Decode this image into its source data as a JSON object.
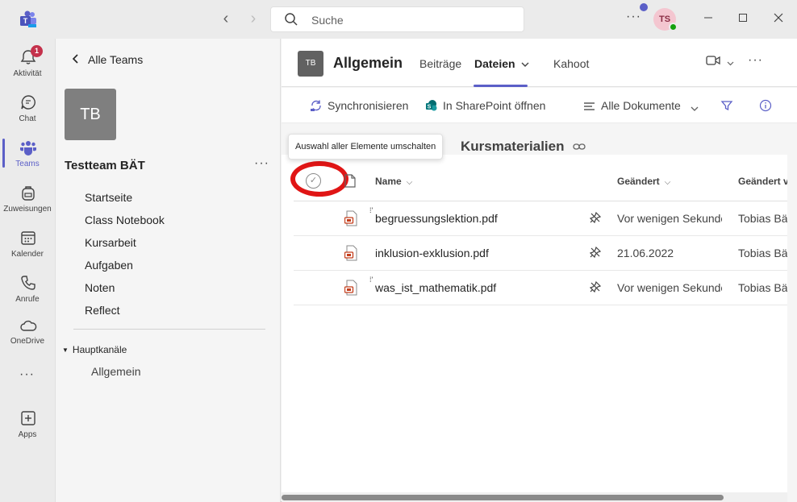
{
  "titlebar": {
    "search_placeholder": "Suche",
    "more": "···",
    "avatar_initials": "TS"
  },
  "rail": {
    "items": [
      {
        "label": "Aktivität",
        "icon": "bell-icon",
        "badge": "1"
      },
      {
        "label": "Chat",
        "icon": "chat-icon"
      },
      {
        "label": "Teams",
        "icon": "teams-icon",
        "active": true
      },
      {
        "label": "Zuweisungen",
        "icon": "backpack-icon"
      },
      {
        "label": "Kalender",
        "icon": "calendar-icon"
      },
      {
        "label": "Anrufe",
        "icon": "phone-icon"
      },
      {
        "label": "OneDrive",
        "icon": "cloud-icon"
      },
      {
        "label": "Apps",
        "icon": "plus-box-icon"
      }
    ],
    "more": "···"
  },
  "team_panel": {
    "back_label": "Alle Teams",
    "avatar_initials": "TB",
    "team_name": "Testteam BÄT",
    "more": "···",
    "links": [
      "Startseite",
      "Class Notebook",
      "Kursarbeit",
      "Aufgaben",
      "Noten",
      "Reflect"
    ],
    "section_title": "Hauptkanäle",
    "channels": [
      "Allgemein"
    ]
  },
  "channel_header": {
    "avatar_initials": "TB",
    "title": "Allgemein",
    "tabs": [
      "Beiträge",
      "Dateien",
      "Kahoot"
    ],
    "active_tab": "Dateien",
    "more": "···"
  },
  "toolbar": {
    "sync_label": "Synchronisieren",
    "sharepoint_label": "In SharePoint öffnen",
    "view_label": "Alle Dokumente"
  },
  "tooltip": "Auswahl aller Elemente umschalten",
  "folder": {
    "title": "Kursmaterialien"
  },
  "table": {
    "columns": [
      "Name",
      "Geändert",
      "Geändert von"
    ],
    "rows": [
      {
        "name": "begruessungslektion.pdf",
        "modified": "Vor wenigen Sekunden",
        "modified_by": "Tobias Bäuerle",
        "new": true
      },
      {
        "name": "inklusion-exklusion.pdf",
        "modified": "21.06.2022",
        "modified_by": "Tobias Bäuerle",
        "new": false
      },
      {
        "name": "was_ist_mathematik.pdf",
        "modified": "Vor wenigen Sekunden",
        "modified_by": "Tobias Bäuerle",
        "new": true
      }
    ]
  },
  "colors": {
    "accent": "#5b5fc7",
    "highlight_ring": "#e01515",
    "badge": "#c4314b",
    "pdf": "#c43e1c"
  }
}
